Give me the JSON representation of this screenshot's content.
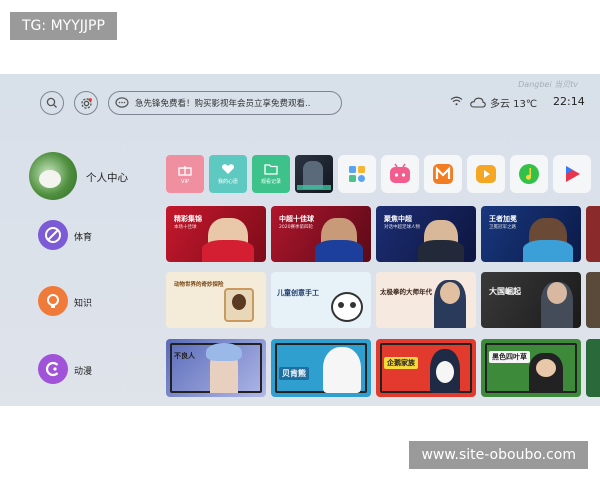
{
  "watermarks": {
    "top": "TG: MYYJJPP",
    "bottom": "www.site-oboubo.com"
  },
  "topbar": {
    "search_text": "急先锋免费看！购买影视年会员立享免费观看..",
    "brand": "Dangbei 当贝tv",
    "weather": "多云 13℃",
    "time": "22:14"
  },
  "sidebar": {
    "profile_label": "个人中心",
    "items": [
      {
        "label": "体育",
        "color": "#7c5bd6",
        "icon": "no-entry-icon"
      },
      {
        "label": "知识",
        "color": "#f07a3a",
        "icon": "bulb-icon"
      },
      {
        "label": "动漫",
        "color": "#a052d8",
        "icon": "c-icon"
      }
    ]
  },
  "apps": [
    {
      "label": "VIP",
      "color": "#f08fa0",
      "icon": "gift-icon"
    },
    {
      "label": "我的心愿",
      "color": "#5ec9c0",
      "icon": "heart-icon"
    },
    {
      "label": "观看记录",
      "color": "#3ec28c",
      "icon": "folder-icon"
    }
  ],
  "sports_cards": [
    {
      "title": "精彩集锦",
      "sub": "本场十佳球",
      "color": "#b8162a"
    },
    {
      "title": "中超十佳球",
      "sub": "2020赛季第四轮",
      "color": "#a4142a"
    },
    {
      "title": "聚焦中超",
      "sub": "对话中超足球人物",
      "color": "#1a2b6e"
    },
    {
      "title": "王者加冕",
      "sub": "卫冕冠军之路",
      "color": "#16337a"
    }
  ],
  "knowledge_cards": [
    {
      "title": "动物世界的奇妙探险",
      "color": "#f4ecd8"
    },
    {
      "title": "儿童创意手工",
      "color": "#e6f2f8"
    },
    {
      "title": "太极拳的大师年代",
      "color": "#f6e9e0"
    },
    {
      "title": "大国崛起",
      "color": "#2d2d2d"
    }
  ],
  "anime_cards": [
    {
      "title": "不良人",
      "color": "#6e7fc8"
    },
    {
      "title": "贝肯熊",
      "color": "#2f9fd0"
    },
    {
      "title": "企鹅家族",
      "color": "#e23b2e"
    },
    {
      "title": "黑色四叶草",
      "color": "#3d8a3a"
    }
  ]
}
